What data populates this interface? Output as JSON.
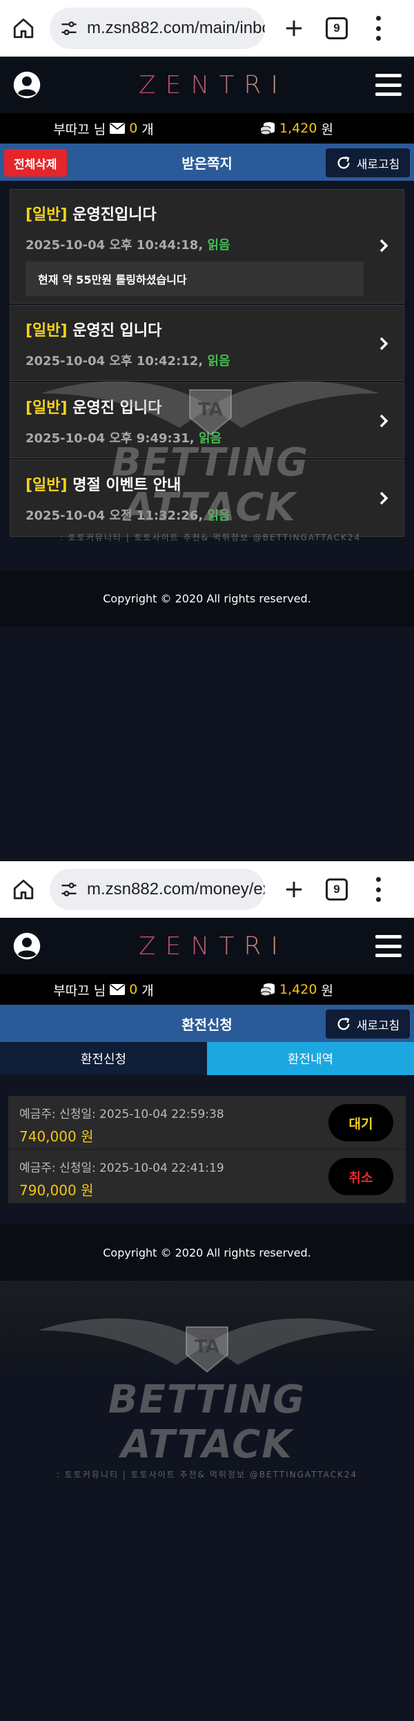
{
  "shot1": {
    "browser": {
      "url": "m.zsn882.com/main/inbo",
      "tab_count": "9"
    },
    "site": {
      "logo": "ZENTRI"
    },
    "userbar": {
      "username": "부따끄 님",
      "message_count": "0",
      "message_unit": "개",
      "balance": "1,420",
      "currency": "원"
    },
    "titlebar": {
      "title": "받은쪽지",
      "delete_all": "전체삭제",
      "refresh": "새로고침"
    },
    "messages": [
      {
        "tag": "[일반]",
        "title": "운영진입니다",
        "date": "2025-10-04 오후 10:44:18,",
        "status": "읽음",
        "preview": "현재 약 55만원 롤링하셨습니다"
      },
      {
        "tag": "[일반]",
        "title": "운영진 입니다",
        "date": "2025-10-04 오후 10:42:12,",
        "status": "읽음"
      },
      {
        "tag": "[일반]",
        "title": "운영진 입니다",
        "date": "2025-10-04 오후 9:49:31,",
        "status": "읽음"
      },
      {
        "tag": "[일반]",
        "title": "명절 이벤트 안내",
        "date": "2025-10-04 오전 11:32:26,",
        "status": "읽음"
      }
    ],
    "footer": "Copyright © 2020 All rights reserved."
  },
  "shot2": {
    "browser": {
      "url": "m.zsn882.com/money/ex",
      "tab_count": "9"
    },
    "site": {
      "logo": "ZENTRI"
    },
    "userbar": {
      "username": "부따끄 님",
      "message_count": "0",
      "message_unit": "개",
      "balance": "1,420",
      "currency": "원"
    },
    "titlebar": {
      "title": "환전신청",
      "refresh": "새로고침"
    },
    "tabs": {
      "apply": "환전신청",
      "history": "환전내역"
    },
    "requests": [
      {
        "meta": "예금주: 신청일: 2025-10-04 22:59:38",
        "amount": "740,000 원",
        "status": "대기"
      },
      {
        "meta": "예금주: 신청일: 2025-10-04 22:41:19",
        "amount": "790,000 원",
        "status": "취소"
      }
    ],
    "footer": "Copyright © 2020 All rights reserved."
  },
  "watermark": {
    "title": "BETTING ATTACK",
    "emblem": "TA",
    "subtitle": ": 토토커뮤니티 | 토토사이트 추천& 먹튀정보 @BETTINGATTACK24"
  },
  "colors": {
    "accent_blue": "#2b5a98",
    "tab_active": "#1da7e0",
    "gold": "#f5c518",
    "read_green": "#3fbf4f",
    "delete_red": "#e5252a"
  }
}
